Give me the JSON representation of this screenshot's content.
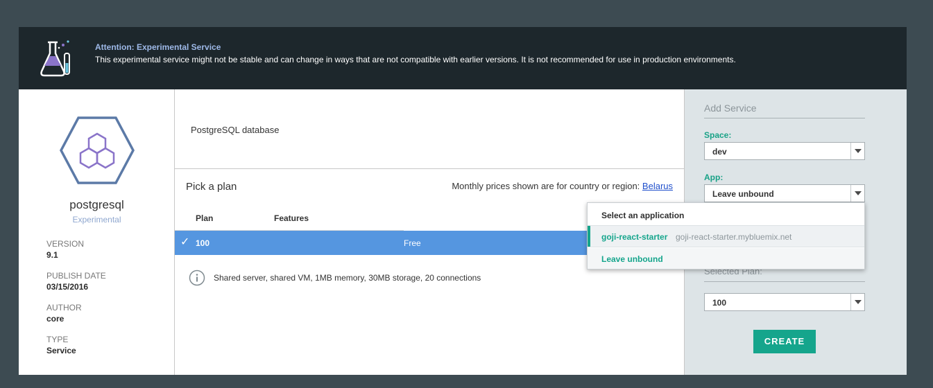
{
  "banner": {
    "title": "Attention: Experimental Service",
    "text": "This experimental service might not be stable and can change in ways that are not compatible with earlier versions. It is not recommended for use in production environments.",
    "icon": "beaker-flask-icon"
  },
  "service": {
    "name": "postgresql",
    "tag": "Experimental",
    "logo_icon": "hexagon-cubes-logo-icon",
    "meta": [
      {
        "label": "VERSION",
        "value": "9.1"
      },
      {
        "label": "PUBLISH DATE",
        "value": "03/15/2016"
      },
      {
        "label": "AUTHOR",
        "value": "core"
      },
      {
        "label": "TYPE",
        "value": "Service"
      }
    ]
  },
  "main": {
    "description": "PostgreSQL database",
    "pick_plan_title": "Pick a plan",
    "region_note": "Monthly prices shown are for country or region:",
    "region_link": "Belarus",
    "columns": {
      "plan": "Plan",
      "features": "Features"
    },
    "selected_plan": {
      "check": "✓",
      "name": "100",
      "price": "Free"
    },
    "plan_feature": "Shared server, shared VM, 1MB memory, 30MB storage, 20 connections"
  },
  "sidebar": {
    "title": "Add Service",
    "space_label": "Space:",
    "space_value": "dev",
    "app_label": "App:",
    "app_value": "Leave unbound",
    "selected_plan_label": "Selected Plan:",
    "selected_plan_value": "100",
    "create_label": "CREATE"
  },
  "dropdown": {
    "header": "Select an application",
    "items": [
      {
        "name": "goji-react-starter",
        "url": "goji-react-starter.mybluemix.net"
      },
      {
        "name": "Leave unbound"
      }
    ]
  },
  "colors": {
    "background": "#3d4b52",
    "banner": "#1d272c",
    "accent": "#15a58c",
    "selected_row": "#5596e0",
    "link": "#1f4fcc"
  }
}
